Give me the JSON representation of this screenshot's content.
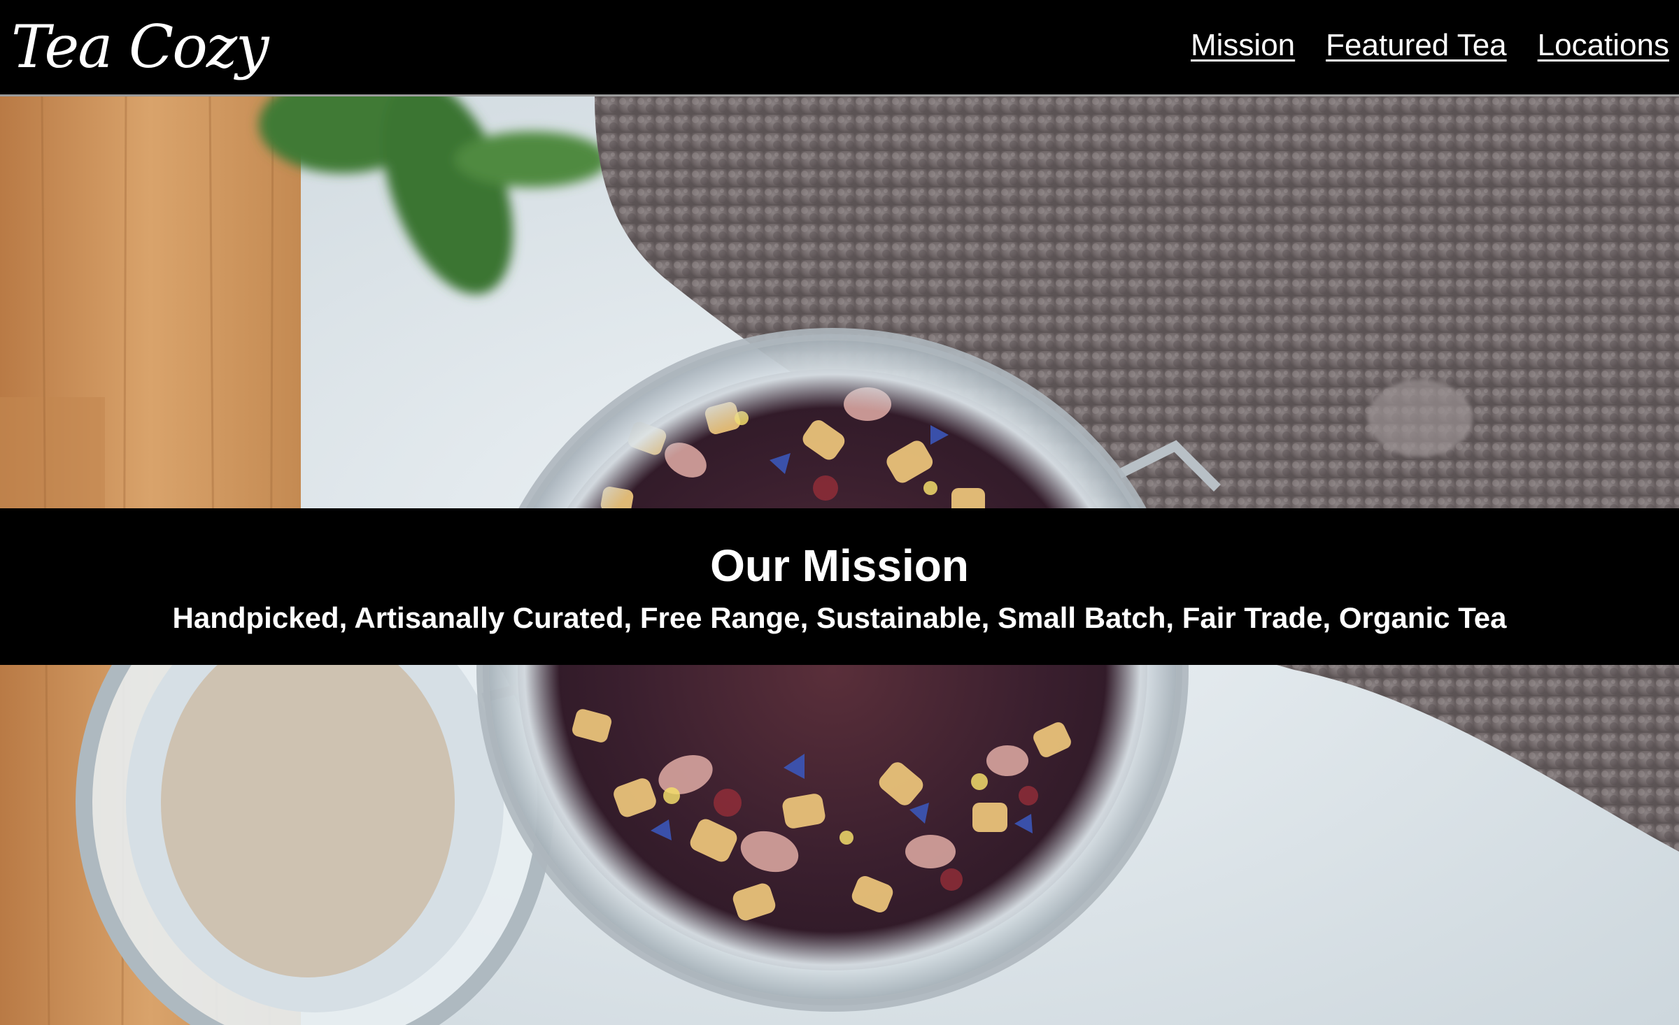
{
  "header": {
    "logo_text": "Tea Cozy",
    "nav": [
      {
        "label": "Mission"
      },
      {
        "label": "Featured Tea"
      },
      {
        "label": "Locations"
      }
    ]
  },
  "hero": {
    "image_subject": "jar of loose leaf herbal tea",
    "banner": {
      "title": "Our Mission",
      "subtitle": "Handpicked, Artisanally Curated, Free Range, Sustainable, Small Batch, Fair Trade, Organic Tea"
    }
  },
  "colors": {
    "header_bg": "#000000",
    "banner_bg": "#000000",
    "text": "#ffffff"
  }
}
